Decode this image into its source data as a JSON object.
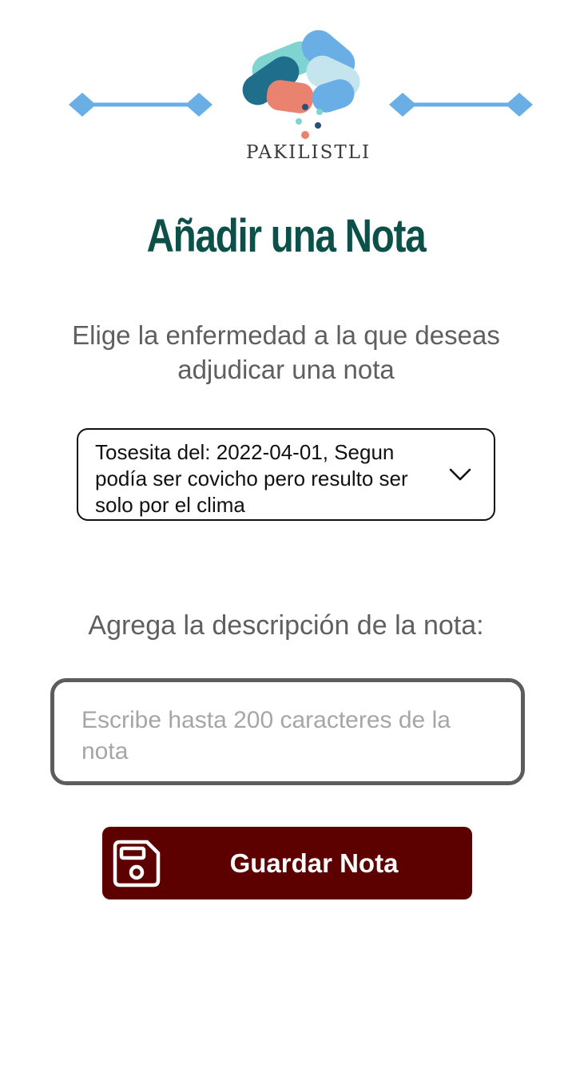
{
  "header": {
    "logo_text": "PAKILISTLI"
  },
  "page": {
    "title": "Añadir una Nota",
    "prompt": "Elige la enfermedad a la que deseas adjudicar una nota",
    "description_label": "Agrega la descripción de la nota:"
  },
  "disease_select": {
    "selected": "Tosesita del: 2022-04-01, Segun podía ser covicho pero resulto ser solo por el clima",
    "icon": "chevron-down-icon"
  },
  "note_input": {
    "value": "",
    "placeholder": "Escribe hasta 200 caracteres de la nota"
  },
  "save_button": {
    "label": "Guardar Nota",
    "icon": "floppy-disk-icon"
  },
  "colors": {
    "title": "#0b5149",
    "button_bg": "#5d0000",
    "deco_blue": "#6aaee6"
  }
}
